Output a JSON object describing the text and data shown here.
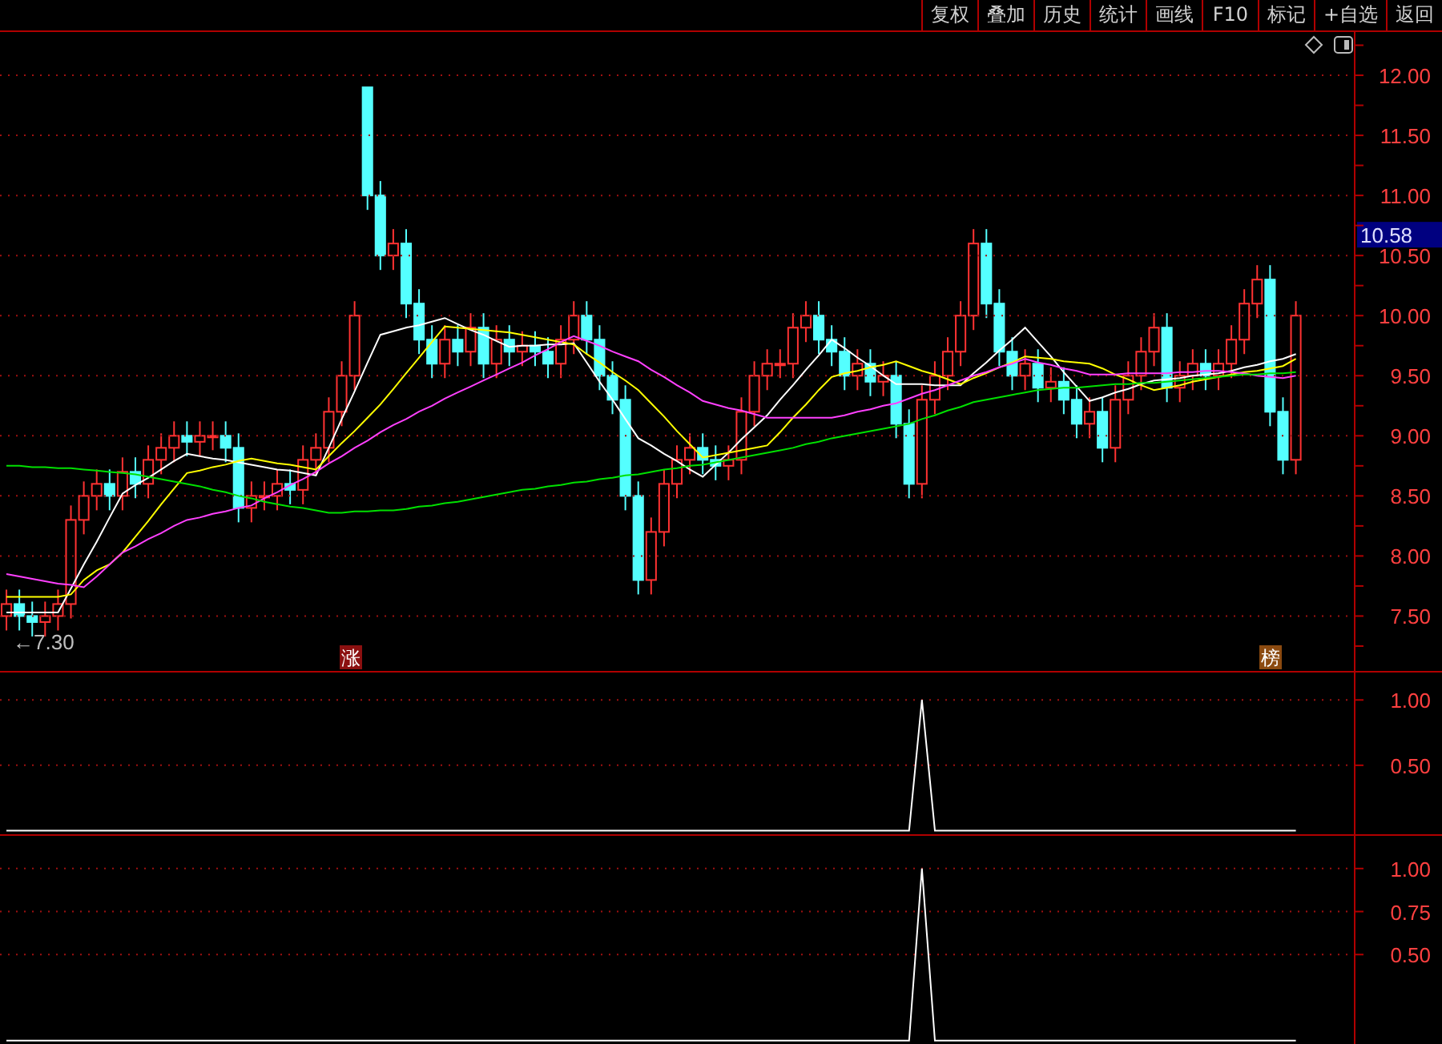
{
  "toolbar": [
    {
      "label": "复权"
    },
    {
      "label": "叠加"
    },
    {
      "label": "历史"
    },
    {
      "label": "统计"
    },
    {
      "label": "画线"
    },
    {
      "label": "F10"
    },
    {
      "label": "标记"
    },
    {
      "label": "+自选"
    },
    {
      "label": "返回"
    }
  ],
  "price_chart": {
    "last_price": "10.58",
    "low_label": "←7.30",
    "badges": [
      {
        "text": "涨",
        "color": "#8b1010"
      },
      {
        "text": "榜",
        "color": "#8b4a10"
      }
    ],
    "chart_data": {
      "type": "candlestick",
      "ylim": [
        7.03,
        12.36
      ],
      "ohlc": [
        [
          7.5,
          7.72,
          7.38,
          7.6
        ],
        [
          7.6,
          7.72,
          7.38,
          7.5
        ],
        [
          7.5,
          7.62,
          7.33,
          7.45
        ],
        [
          7.45,
          7.62,
          7.33,
          7.5
        ],
        [
          7.5,
          7.72,
          7.38,
          7.6
        ],
        [
          7.6,
          8.42,
          7.48,
          8.3
        ],
        [
          8.3,
          8.62,
          8.18,
          8.5
        ],
        [
          8.5,
          8.72,
          8.38,
          8.6
        ],
        [
          8.6,
          8.72,
          8.38,
          8.5
        ],
        [
          8.5,
          8.82,
          8.38,
          8.7
        ],
        [
          8.7,
          8.82,
          8.48,
          8.6
        ],
        [
          8.6,
          8.92,
          8.48,
          8.8
        ],
        [
          8.8,
          9.02,
          8.68,
          8.9
        ],
        [
          8.9,
          9.12,
          8.78,
          9.0
        ],
        [
          9.0,
          9.12,
          8.83,
          8.95
        ],
        [
          8.95,
          9.12,
          8.83,
          9.0
        ],
        [
          9.0,
          9.12,
          8.88,
          9.0
        ],
        [
          9.0,
          9.12,
          8.78,
          8.9
        ],
        [
          8.9,
          9.02,
          8.28,
          8.4
        ],
        [
          8.4,
          8.62,
          8.28,
          8.5
        ],
        [
          8.5,
          8.62,
          8.38,
          8.5
        ],
        [
          8.5,
          8.72,
          8.38,
          8.6
        ],
        [
          8.6,
          8.72,
          8.43,
          8.55
        ],
        [
          8.55,
          8.92,
          8.43,
          8.8
        ],
        [
          8.8,
          9.02,
          8.68,
          8.9
        ],
        [
          8.9,
          9.32,
          8.78,
          9.2
        ],
        [
          9.2,
          9.62,
          9.08,
          9.5
        ],
        [
          9.5,
          10.12,
          9.38,
          10.0
        ],
        [
          11.9,
          11.9,
          10.88,
          11.0
        ],
        [
          11.0,
          11.12,
          10.38,
          10.5
        ],
        [
          10.5,
          10.72,
          10.38,
          10.6
        ],
        [
          10.6,
          10.72,
          9.98,
          10.1
        ],
        [
          10.1,
          10.22,
          9.68,
          9.8
        ],
        [
          9.8,
          9.92,
          9.48,
          9.6
        ],
        [
          9.6,
          9.92,
          9.48,
          9.8
        ],
        [
          9.8,
          9.92,
          9.58,
          9.7
        ],
        [
          9.7,
          10.02,
          9.58,
          9.9
        ],
        [
          9.9,
          10.02,
          9.48,
          9.6
        ],
        [
          9.6,
          9.92,
          9.48,
          9.8
        ],
        [
          9.8,
          9.92,
          9.58,
          9.7
        ],
        [
          9.7,
          9.87,
          9.58,
          9.75
        ],
        [
          9.75,
          9.87,
          9.58,
          9.7
        ],
        [
          9.7,
          9.82,
          9.48,
          9.6
        ],
        [
          9.6,
          9.92,
          9.48,
          9.8
        ],
        [
          9.8,
          10.12,
          9.68,
          10.0
        ],
        [
          10.0,
          10.12,
          9.68,
          9.8
        ],
        [
          9.8,
          9.92,
          9.38,
          9.5
        ],
        [
          9.5,
          9.62,
          9.18,
          9.3
        ],
        [
          9.3,
          9.42,
          8.38,
          8.5
        ],
        [
          8.5,
          8.62,
          7.68,
          7.8
        ],
        [
          7.8,
          8.32,
          7.68,
          8.2
        ],
        [
          8.2,
          8.72,
          8.08,
          8.6
        ],
        [
          8.6,
          8.92,
          8.48,
          8.8
        ],
        [
          8.8,
          9.02,
          8.68,
          8.9
        ],
        [
          8.9,
          9.02,
          8.68,
          8.8
        ],
        [
          8.8,
          8.92,
          8.63,
          8.75
        ],
        [
          8.75,
          8.92,
          8.63,
          8.8
        ],
        [
          8.8,
          9.32,
          8.68,
          9.2
        ],
        [
          9.2,
          9.62,
          9.08,
          9.5
        ],
        [
          9.5,
          9.72,
          9.38,
          9.6
        ],
        [
          9.6,
          9.72,
          9.48,
          9.6
        ],
        [
          9.6,
          10.02,
          9.48,
          9.9
        ],
        [
          9.9,
          10.12,
          9.78,
          10.0
        ],
        [
          10.0,
          10.12,
          9.68,
          9.8
        ],
        [
          9.8,
          9.92,
          9.58,
          9.7
        ],
        [
          9.7,
          9.82,
          9.38,
          9.5
        ],
        [
          9.5,
          9.72,
          9.38,
          9.6
        ],
        [
          9.6,
          9.72,
          9.33,
          9.45
        ],
        [
          9.45,
          9.62,
          9.33,
          9.5
        ],
        [
          9.5,
          9.62,
          8.98,
          9.1
        ],
        [
          9.1,
          9.22,
          8.48,
          8.6
        ],
        [
          8.6,
          9.42,
          8.48,
          9.3
        ],
        [
          9.3,
          9.62,
          9.18,
          9.5
        ],
        [
          9.5,
          9.82,
          9.38,
          9.7
        ],
        [
          9.7,
          10.12,
          9.58,
          10.0
        ],
        [
          10.0,
          10.72,
          9.88,
          10.6
        ],
        [
          10.6,
          10.72,
          9.98,
          10.1
        ],
        [
          10.1,
          10.22,
          9.58,
          9.7
        ],
        [
          9.7,
          9.82,
          9.38,
          9.5
        ],
        [
          9.5,
          9.72,
          9.38,
          9.6
        ],
        [
          9.6,
          9.72,
          9.28,
          9.4
        ],
        [
          9.4,
          9.57,
          9.28,
          9.45
        ],
        [
          9.45,
          9.57,
          9.18,
          9.3
        ],
        [
          9.3,
          9.42,
          8.98,
          9.1
        ],
        [
          9.1,
          9.32,
          8.98,
          9.2
        ],
        [
          9.2,
          9.32,
          8.78,
          8.9
        ],
        [
          8.9,
          9.42,
          8.78,
          9.3
        ],
        [
          9.3,
          9.62,
          9.18,
          9.5
        ],
        [
          9.5,
          9.82,
          9.38,
          9.7
        ],
        [
          9.7,
          10.02,
          9.58,
          9.9
        ],
        [
          9.9,
          10.02,
          9.28,
          9.4
        ],
        [
          9.4,
          9.62,
          9.28,
          9.5
        ],
        [
          9.5,
          9.72,
          9.38,
          9.6
        ],
        [
          9.6,
          9.72,
          9.38,
          9.5
        ],
        [
          9.5,
          9.72,
          9.38,
          9.6
        ],
        [
          9.6,
          9.92,
          9.48,
          9.8
        ],
        [
          9.8,
          10.22,
          9.68,
          10.1
        ],
        [
          10.1,
          10.42,
          9.98,
          10.3
        ],
        [
          10.3,
          10.42,
          9.08,
          9.2
        ],
        [
          9.2,
          9.32,
          8.68,
          8.8
        ],
        [
          8.8,
          10.12,
          8.68,
          10.0
        ],
        null,
        null,
        null,
        null
      ]
    },
    "moving_averages": {
      "chart_data": {
        "type": "line",
        "grid": true,
        "ylim": [
          7.03,
          12.36
        ],
        "yticks": [
          {
            "value": 12,
            "label": "12.00"
          },
          {
            "value": 11.5,
            "label": "11.50"
          },
          {
            "value": 11,
            "label": "11.00"
          },
          {
            "value": 10.5,
            "label": "10.50"
          },
          {
            "value": 10,
            "label": "10.00"
          },
          {
            "value": 9.5,
            "label": "9.50"
          },
          {
            "value": 9,
            "label": "9.00"
          },
          {
            "value": 8.5,
            "label": "8.50"
          },
          {
            "value": 8,
            "label": "8.00"
          },
          {
            "value": 7.5,
            "label": "7.50"
          }
        ],
        "series": [
          {
            "color": "#ffffff",
            "values": [
              7.53,
              7.53,
              7.53,
              7.53,
              7.53,
              7.73,
              7.93,
              8.12,
              8.32,
              8.52,
              8.59,
              8.65,
              8.72,
              8.79,
              8.85,
              8.83,
              8.81,
              8.8,
              8.78,
              8.76,
              8.74,
              8.72,
              8.71,
              8.69,
              8.67,
              8.9,
              9.14,
              9.37,
              9.61,
              9.84,
              9.87,
              9.9,
              9.92,
              9.95,
              9.98,
              9.93,
              9.88,
              9.84,
              9.79,
              9.74,
              9.75,
              9.75,
              9.76,
              9.76,
              9.77,
              9.61,
              9.45,
              9.3,
              9.14,
              8.98,
              8.92,
              8.85,
              8.79,
              8.72,
              8.66,
              8.76,
              8.86,
              8.97,
              9.07,
              9.17,
              9.3,
              9.42,
              9.55,
              9.67,
              9.8,
              9.73,
              9.65,
              9.58,
              9.5,
              9.43,
              9.43,
              9.43,
              9.42,
              9.42,
              9.42,
              9.52,
              9.61,
              9.71,
              9.8,
              9.9,
              9.78,
              9.66,
              9.53,
              9.41,
              9.29,
              9.32,
              9.36,
              9.39,
              9.43,
              9.46,
              9.47,
              9.48,
              9.5,
              9.51,
              9.52,
              9.54,
              9.57,
              9.59,
              9.62,
              9.64,
              9.68,
              null,
              null,
              null,
              null
            ]
          },
          {
            "color": "#ffff00",
            "values": [
              7.66,
              7.66,
              7.66,
              7.66,
              7.66,
              7.68,
              7.8,
              7.88,
              7.93,
              8.03,
              8.16,
              8.29,
              8.43,
              8.56,
              8.69,
              8.71,
              8.74,
              8.76,
              8.79,
              8.81,
              8.79,
              8.77,
              8.76,
              8.74,
              8.72,
              8.83,
              8.94,
              9.04,
              9.15,
              9.26,
              9.39,
              9.52,
              9.65,
              9.78,
              9.91,
              9.9,
              9.89,
              9.88,
              9.87,
              9.86,
              9.84,
              9.82,
              9.8,
              9.78,
              9.76,
              9.68,
              9.61,
              9.53,
              9.46,
              9.38,
              9.27,
              9.16,
              9.04,
              8.93,
              8.82,
              8.84,
              8.86,
              8.88,
              8.9,
              8.92,
              9.03,
              9.15,
              9.26,
              9.38,
              9.49,
              9.52,
              9.54,
              9.57,
              9.59,
              9.62,
              9.58,
              9.54,
              9.51,
              9.47,
              9.43,
              9.48,
              9.52,
              9.57,
              9.61,
              9.66,
              9.65,
              9.64,
              9.62,
              9.61,
              9.6,
              9.56,
              9.51,
              9.47,
              9.42,
              9.38,
              9.4,
              9.42,
              9.45,
              9.47,
              9.49,
              9.51,
              9.53,
              9.54,
              9.56,
              9.58,
              9.64,
              null,
              null,
              null,
              null
            ]
          },
          {
            "color": "#ff40ff",
            "values": [
              7.85,
              7.83,
              7.81,
              7.79,
              7.77,
              7.76,
              7.74,
              7.83,
              7.93,
              8.03,
              8.08,
              8.14,
              8.19,
              8.25,
              8.3,
              8.32,
              8.35,
              8.37,
              8.4,
              8.42,
              8.48,
              8.53,
              8.59,
              8.64,
              8.7,
              8.77,
              8.83,
              8.9,
              8.96,
              9.03,
              9.09,
              9.14,
              9.2,
              9.25,
              9.31,
              9.36,
              9.41,
              9.46,
              9.51,
              9.56,
              9.61,
              9.67,
              9.72,
              9.78,
              9.83,
              9.79,
              9.75,
              9.7,
              9.66,
              9.62,
              9.55,
              9.49,
              9.42,
              9.36,
              9.29,
              9.26,
              9.23,
              9.21,
              9.18,
              9.15,
              9.15,
              9.15,
              9.15,
              9.15,
              9.15,
              9.17,
              9.2,
              9.22,
              9.25,
              9.27,
              9.31,
              9.35,
              9.38,
              9.42,
              9.46,
              9.5,
              9.53,
              9.57,
              9.6,
              9.64,
              9.61,
              9.59,
              9.56,
              9.54,
              9.51,
              9.51,
              9.51,
              9.52,
              9.52,
              9.52,
              9.52,
              9.53,
              9.53,
              9.54,
              9.54,
              9.53,
              9.52,
              9.5,
              9.49,
              9.48,
              9.5,
              null,
              null,
              null,
              null
            ]
          },
          {
            "color": "#00e000",
            "values": [
              8.75,
              8.75,
              8.74,
              8.74,
              8.73,
              8.73,
              8.72,
              8.71,
              8.7,
              8.69,
              8.68,
              8.66,
              8.64,
              8.62,
              8.6,
              8.58,
              8.55,
              8.53,
              8.5,
              8.48,
              8.45,
              8.43,
              8.41,
              8.4,
              8.38,
              8.36,
              8.36,
              8.37,
              8.37,
              8.38,
              8.38,
              8.39,
              8.41,
              8.42,
              8.44,
              8.45,
              8.47,
              8.49,
              8.51,
              8.53,
              8.55,
              8.56,
              8.58,
              8.59,
              8.61,
              8.62,
              8.64,
              8.65,
              8.67,
              8.68,
              8.7,
              8.72,
              8.73,
              8.75,
              8.76,
              8.78,
              8.8,
              8.82,
              8.84,
              8.86,
              8.88,
              8.9,
              8.93,
              8.95,
              8.98,
              9.0,
              9.02,
              9.04,
              9.06,
              9.08,
              9.1,
              9.14,
              9.17,
              9.21,
              9.24,
              9.28,
              9.3,
              9.32,
              9.34,
              9.36,
              9.38,
              9.39,
              9.4,
              9.4,
              9.41,
              9.42,
              9.43,
              9.43,
              9.44,
              9.44,
              9.45,
              9.46,
              9.47,
              9.48,
              9.49,
              9.5,
              9.51,
              9.51,
              9.52,
              9.52,
              9.53,
              null,
              null,
              null,
              null
            ]
          }
        ]
      }
    }
  },
  "indicator_panels": [
    {
      "chart_data": {
        "type": "line",
        "grid": true,
        "ylim": [
          -0.04,
          1.21
        ],
        "yticks": [
          {
            "value": 1,
            "label": "1.00"
          },
          {
            "value": 0.5,
            "label": "0.50"
          }
        ],
        "series": [
          {
            "color": "#ffffff",
            "values": [
              0,
              0,
              0,
              0,
              0,
              0,
              0,
              0,
              0,
              0,
              0,
              0,
              0,
              0,
              0,
              0,
              0,
              0,
              0,
              0,
              0,
              0,
              0,
              0,
              0,
              0,
              0,
              0,
              0,
              0,
              0,
              0,
              0,
              0,
              0,
              0,
              0,
              0,
              0,
              0,
              0,
              0,
              0,
              0,
              0,
              0,
              0,
              0,
              0,
              0,
              0,
              0,
              0,
              0,
              0,
              0,
              0,
              0,
              0,
              0,
              0,
              0,
              0,
              0,
              0,
              0,
              0,
              0,
              0,
              0,
              0,
              1,
              0,
              0,
              0,
              0,
              0,
              0,
              0,
              0,
              0,
              0,
              0,
              0,
              0,
              0,
              0,
              0,
              0,
              0,
              0,
              0,
              0,
              0,
              0,
              0,
              0,
              0,
              0,
              0,
              0,
              null,
              null,
              null,
              null
            ]
          }
        ]
      }
    },
    {
      "chart_data": {
        "type": "line",
        "grid": true,
        "ylim": [
          -0.02,
          1.19
        ],
        "yticks": [
          {
            "value": 1,
            "label": "1.00"
          },
          {
            "value": 0.75,
            "label": "0.75"
          },
          {
            "value": 0.5,
            "label": "0.50"
          }
        ],
        "series": [
          {
            "color": "#ffffff",
            "values": [
              0,
              0,
              0,
              0,
              0,
              0,
              0,
              0,
              0,
              0,
              0,
              0,
              0,
              0,
              0,
              0,
              0,
              0,
              0,
              0,
              0,
              0,
              0,
              0,
              0,
              0,
              0,
              0,
              0,
              0,
              0,
              0,
              0,
              0,
              0,
              0,
              0,
              0,
              0,
              0,
              0,
              0,
              0,
              0,
              0,
              0,
              0,
              0,
              0,
              0,
              0,
              0,
              0,
              0,
              0,
              0,
              0,
              0,
              0,
              0,
              0,
              0,
              0,
              0,
              0,
              0,
              0,
              0,
              0,
              0,
              0,
              1,
              0,
              0,
              0,
              0,
              0,
              0,
              0,
              0,
              0,
              0,
              0,
              0,
              0,
              0,
              0,
              0,
              0,
              0,
              0,
              0,
              0,
              0,
              0,
              0,
              0,
              0,
              0,
              0,
              0,
              null,
              null,
              null,
              null
            ]
          }
        ]
      }
    }
  ]
}
